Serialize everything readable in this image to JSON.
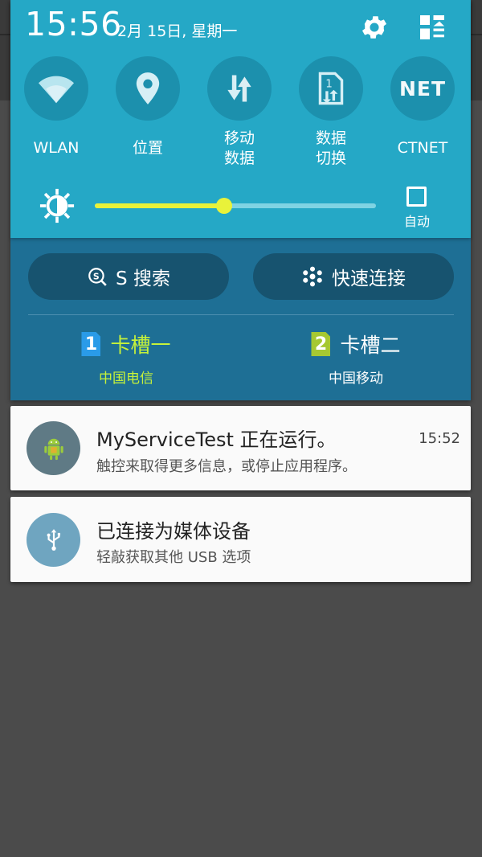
{
  "status_bar": {
    "time": "15:56",
    "date": "2月 15日, 星期一"
  },
  "quick_settings": {
    "tiles": [
      {
        "id": "wlan",
        "label": "WLAN",
        "icon": "wifi-icon"
      },
      {
        "id": "location",
        "label": "位置",
        "icon": "location-pin-icon"
      },
      {
        "id": "mobile_data",
        "label_line1": "移动",
        "label_line2": "数据",
        "icon": "mobile-data-icon"
      },
      {
        "id": "data_switch",
        "label_line1": "数据",
        "label_line2": "切换",
        "icon": "sim-switch-icon"
      },
      {
        "id": "ctnet",
        "label": "CTNET",
        "icon_text": "NET"
      }
    ],
    "brightness": {
      "level": 0.46,
      "auto_label": "自动",
      "auto_checked": false
    }
  },
  "actions": {
    "s_search": "S 搜索",
    "quick_connect": "快速连接"
  },
  "sim": {
    "sim1": {
      "number": "1",
      "name": "卡槽一",
      "operator": "中国电信",
      "color": "#c6f23a",
      "badge_color": "#2a9be8"
    },
    "sim2": {
      "number": "2",
      "name": "卡槽二",
      "operator": "中国移动",
      "color": "#ffffff",
      "badge_color": "#a6c832"
    }
  },
  "notifications": [
    {
      "title": "MyServiceTest 正在运行。",
      "subtitle": "触控来取得更多信息，或停止应用程序。",
      "time": "15:52",
      "icon": "android-app-icon",
      "avatar_color": "#5f7a85"
    },
    {
      "title": "已连接为媒体设备",
      "subtitle": "轻敲获取其他 USB 选项",
      "icon": "usb-icon",
      "avatar_color": "#6fa5c0"
    }
  ],
  "colors": {
    "panel_top": "#25a8c6",
    "panel_bottom": "#1e6f95",
    "accent": "#e9f23a"
  }
}
